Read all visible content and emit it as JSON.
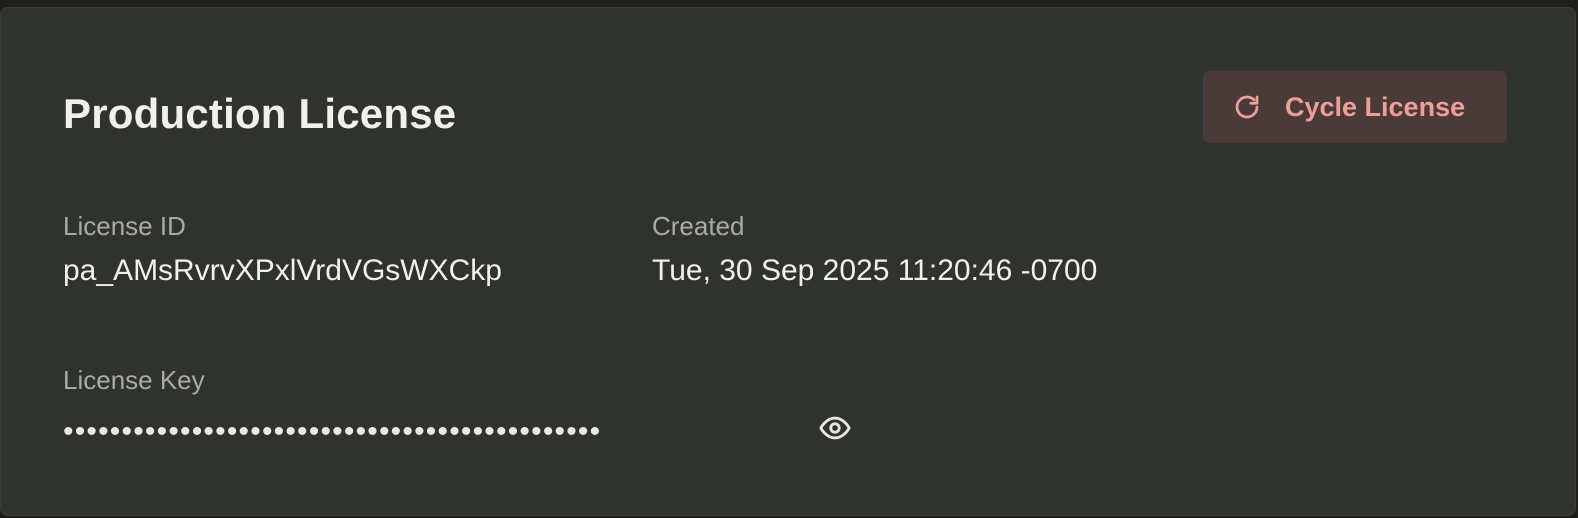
{
  "card": {
    "title": "Production License",
    "cycle_button_label": "Cycle License",
    "cycle_icon": "refresh-icon",
    "license_id_label": "License ID",
    "license_id_value": "pa_AMsRvrvXPxlVrdVGsWXCkp",
    "created_label": "Created",
    "created_value": "Tue, 30 Sep 2025 11:20:46 -0700",
    "license_key_label": "License Key",
    "license_key_masked": "••••••••••••••••••••••••••••••••••••••••••••••",
    "reveal_icon": "eye-icon"
  },
  "colors": {
    "card_bg": "#30322f",
    "button_bg": "#4a3a38",
    "button_accent": "#f19e98",
    "text_primary": "#f0f0ee",
    "text_muted": "#a9aba7"
  }
}
